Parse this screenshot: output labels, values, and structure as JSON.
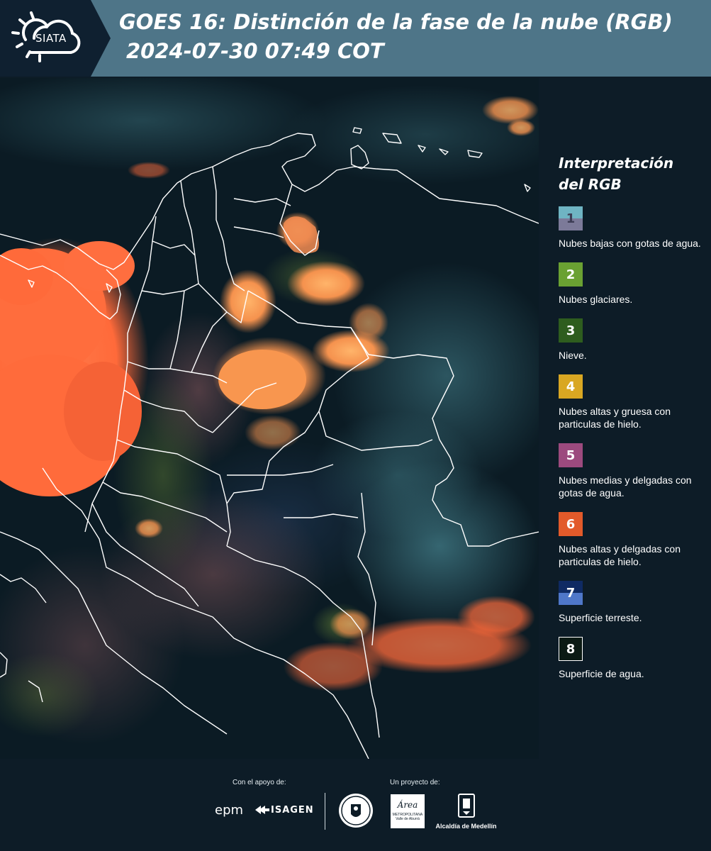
{
  "header": {
    "logo_text": "SIATA",
    "title": "GOES 16: Distinción de la fase de la nube (RGB)",
    "subtitle": "2024-07-30 07:49 COT"
  },
  "legend": {
    "title_line1": "Interpretación",
    "title_line2": "del RGB",
    "items": [
      {
        "number": "1",
        "label": "Nubes bajas con gotas de agua.",
        "color_top": "#6fb4c3",
        "color_bottom": "#7c7a99"
      },
      {
        "number": "2",
        "label": "Nubes glaciares.",
        "color_top": "#6aa132",
        "color_bottom": "#6aa132"
      },
      {
        "number": "3",
        "label": "Nieve.",
        "color_top": "#2e5d1e",
        "color_bottom": "#2e5d1e"
      },
      {
        "number": "4",
        "label": "Nubes altas y gruesa con particulas de hielo.",
        "color_top": "#d9a722",
        "color_bottom": "#d9a722"
      },
      {
        "number": "5",
        "label": "Nubes medias y delgadas con gotas de agua.",
        "color_top": "#9c4a7e",
        "color_bottom": "#9c4a7e"
      },
      {
        "number": "6",
        "label": "Nubes altas y delgadas con particulas de hielo.",
        "color_top": "#e25a2a",
        "color_bottom": "#e25a2a"
      },
      {
        "number": "7",
        "label": "Superficie terreste.",
        "color_top": "#0f2a63",
        "color_bottom": "#4f77c9"
      },
      {
        "number": "8",
        "label": "Superficie de agua.",
        "color_top": "#0b1a14",
        "color_bottom": "#0b1a14"
      }
    ]
  },
  "footer": {
    "support_label": "Con el apoyo de:",
    "project_label": "Un proyecto de:",
    "sponsor1": "epm",
    "sponsor2": "ISAGEN",
    "partner_area_line1": "Área",
    "partner_area_line2": "METROPOLITANA",
    "partner_area_line3": "Valle de Aburrá",
    "partner_medellin": "Alcaldía de Medellín"
  },
  "colors": {
    "header_bg": "#4e7588",
    "logo_bg": "#0f2030",
    "page_bg": "#0d1c27",
    "cloud_orange": "#ff6a3a",
    "border_white": "#ffffff"
  }
}
